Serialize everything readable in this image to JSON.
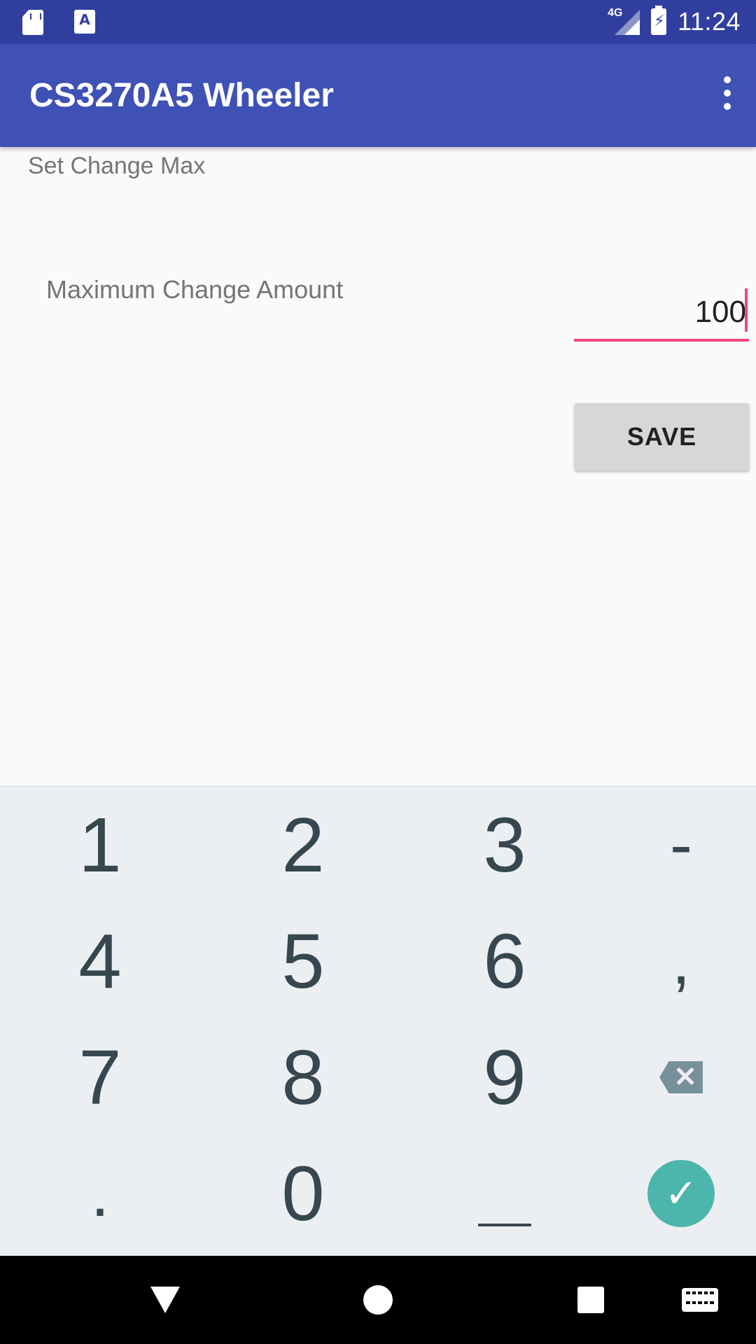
{
  "status_bar": {
    "notification_icons": [
      "sd-card-icon",
      "a-app-icon"
    ],
    "network": "4G",
    "clock": "11:24",
    "a_icon_glyph": "A"
  },
  "app_bar": {
    "title": "CS3270A5 Wheeler",
    "overflow_icon": "more-vert-icon"
  },
  "content": {
    "section_label": "Set Change Max",
    "field_label": "Maximum Change Amount",
    "amount_value": "100",
    "save_label": "SAVE"
  },
  "keyboard": {
    "rows": [
      [
        "1",
        "2",
        "3",
        "-"
      ],
      [
        "4",
        "5",
        "6",
        ","
      ],
      [
        "7",
        "8",
        "9",
        "backspace-icon"
      ],
      [
        ".",
        "0",
        "space-icon",
        "done-icon"
      ]
    ],
    "accent_color": "#4db6ac"
  },
  "nav_bar": {
    "buttons": [
      "back-icon",
      "home-icon",
      "recents-icon",
      "keyboard-switch-icon"
    ]
  },
  "colors": {
    "status_bar": "#303f9f",
    "app_bar": "#3f51b5",
    "input_accent": "#f0487e"
  }
}
